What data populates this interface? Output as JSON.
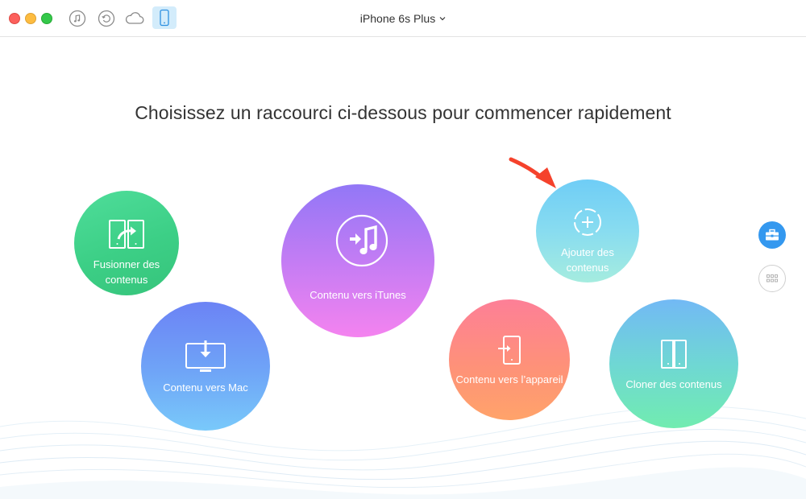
{
  "window": {
    "device_name": "iPhone 6s Plus"
  },
  "toolbar": {
    "icons": [
      "music-note-icon",
      "restore-icon",
      "cloud-icon",
      "phone-icon"
    ],
    "active": "phone-icon"
  },
  "main": {
    "headline": "Choisissez un raccourci ci-dessous pour commencer rapidement"
  },
  "shortcuts": {
    "fusion": {
      "label": "Fusionner des contenus",
      "icon": "merge-devices-icon"
    },
    "mac": {
      "label": "Contenu vers Mac",
      "icon": "monitor-download-icon"
    },
    "itunes": {
      "label": "Contenu vers iTunes",
      "icon": "itunes-icon"
    },
    "ajouter": {
      "label": "Ajouter des contenus",
      "icon": "add-circle-icon"
    },
    "appareil": {
      "label": "Contenu vers l’appareil",
      "icon": "phone-import-icon"
    },
    "cloner": {
      "label": "Cloner des contenus",
      "icon": "clone-devices-icon"
    }
  },
  "sidebar": {
    "buttons": [
      "toolbox-icon",
      "grid-icon"
    ]
  },
  "colors": {
    "accent": "#3498ef",
    "highlight_arrow": "#f5422c",
    "fusion": "#3ccf86",
    "mac": "#6fa5f7",
    "itunes": "#c37cf4",
    "ajouter": "#88dcf0",
    "appareil": "#fe9179",
    "cloner": "#6fd7d4"
  }
}
